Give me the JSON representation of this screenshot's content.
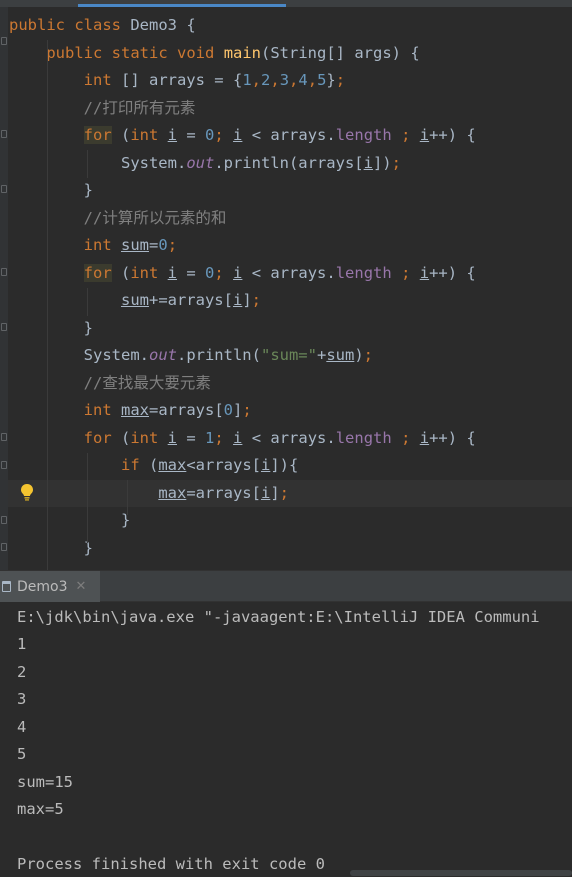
{
  "editor": {
    "lines": [
      "public class Demo3 {",
      "    public static void main(String[] args) {",
      "        int [] arrays = {1,2,3,4,5};",
      "        //打印所有元素",
      "        for (int i = 0; i < arrays.length ; i++) {",
      "            System.out.println(arrays[i]);",
      "        }",
      "        //计算所以元素的和",
      "        int sum=0;",
      "        for (int i = 0; i < arrays.length ; i++) {",
      "            sum+=arrays[i];",
      "        }",
      "        System.out.println(\"sum=\"+sum);",
      "        //查找最大要元素",
      "        int max=arrays[0];",
      "        for (int i = 1; i < arrays.length ; i++) {",
      "            if (max<arrays[i]){",
      "                max=arrays[i];",
      "            }",
      "        }"
    ],
    "intention_icon": "lightbulb-icon"
  },
  "run_panel": {
    "tab_label": "Demo3",
    "tab_icon": "run-config-icon",
    "close_icon": "close-icon"
  },
  "console": {
    "lines": [
      "E:\\jdk\\bin\\java.exe \"-javaagent:E:\\IntelliJ IDEA Communi",
      "1",
      "2",
      "3",
      "4",
      "5",
      "sum=15",
      "max=5",
      "",
      "Process finished with exit code 0"
    ]
  },
  "colors": {
    "background": "#2b2b2b",
    "keyword": "#cc7832",
    "method": "#ffc66d",
    "number": "#6897bb",
    "comment": "#808080",
    "string": "#6a8759",
    "field": "#9876aa"
  }
}
